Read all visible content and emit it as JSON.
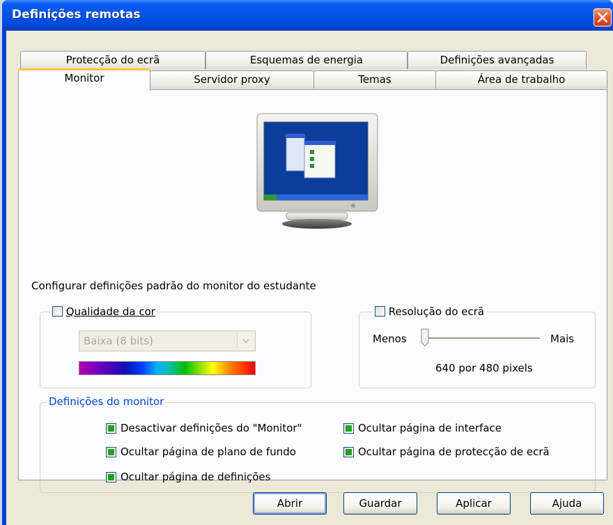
{
  "window": {
    "title": "Definições remotas"
  },
  "tabs": {
    "row_back": [
      "Protecção do ecrã",
      "Esquemas de energia",
      "Definições avançadas"
    ],
    "row_front": [
      "Monitor",
      "Servidor proxy",
      "Temas",
      "Área de trabalho"
    ],
    "active": "Monitor"
  },
  "main": {
    "heading": "Configurar definições padrão do monitor do estudante",
    "color_quality": {
      "label": "Qualidade da cor",
      "checked": false,
      "select_value": "Baixa (8 bits)"
    },
    "resolution": {
      "label": "Resolução do ecrã",
      "checked": false,
      "min_label": "Menos",
      "max_label": "Mais",
      "value_text": "640 por 480 pixels",
      "slider_position": 0
    },
    "monitor_settings": {
      "title": "Definições do monitor",
      "options": [
        {
          "label": "Desactivar definições do \"Monitor\"",
          "checked": true
        },
        {
          "label": "Ocultar página de interface",
          "checked": true
        },
        {
          "label": "Ocultar página de plano de fundo",
          "checked": true
        },
        {
          "label": "Ocultar página de protecção de ecrã",
          "checked": true
        },
        {
          "label": "Ocultar página de definições",
          "checked": true
        }
      ]
    }
  },
  "buttons": {
    "open": "Abrir",
    "save": "Guardar",
    "apply": "Aplicar",
    "help": "Ajuda"
  },
  "colors": {
    "titlebar": "#0454e6",
    "active_tab_accent": "#ffc83c",
    "check_fill": "#21a121",
    "group_title": "#0046d5"
  }
}
